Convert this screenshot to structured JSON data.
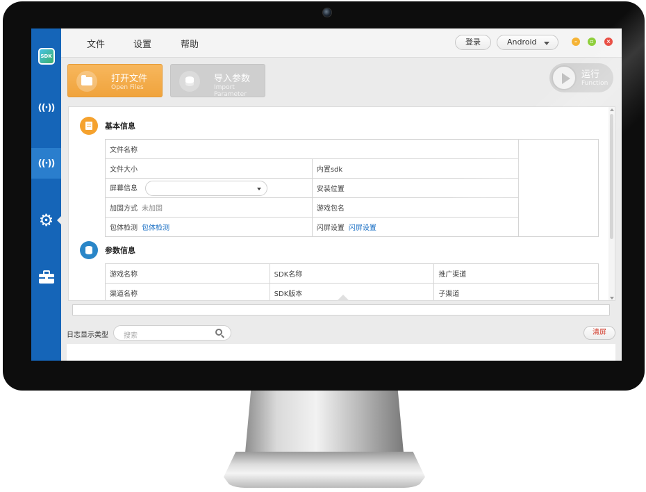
{
  "menu": {
    "file": "文件",
    "settings": "设置",
    "help": "帮助"
  },
  "header": {
    "login": "登录",
    "platform": "Android"
  },
  "sidebar": {
    "logo_text": "SDK",
    "items": [
      {
        "icon": "wireless-icon",
        "glyph": "((·))"
      },
      {
        "icon": "wireless-off-icon",
        "glyph": "((·))"
      },
      {
        "icon": "gear-icon",
        "glyph": "⚙"
      },
      {
        "icon": "toolbox-icon",
        "glyph": "🧰"
      }
    ]
  },
  "toolbar": {
    "open": {
      "title": "打开文件",
      "subtitle": "Open Files"
    },
    "import": {
      "title": "导入参数",
      "subtitle": "Import Parameter"
    },
    "run": {
      "title": "运行",
      "subtitle": "Function"
    }
  },
  "basic_info": {
    "title": "基本信息",
    "file_name": "文件名称",
    "file_size": "文件大小",
    "builtin_sdk": "内置sdk",
    "screen_info": "屏幕信息",
    "install_location": "安装位置",
    "protection_method": "加固方式",
    "protection_value": "未加固",
    "game_package": "游戏包名",
    "package_check": "包体检测",
    "package_check_link": "包体检测",
    "splash_settings": "闪屏设置",
    "splash_settings_link": "闪屏设置"
  },
  "params_info": {
    "title": "参数信息",
    "headers": [
      [
        "游戏名称",
        "SDK名称",
        "推广渠道"
      ],
      [
        "渠道名称",
        "SDK版本",
        "子渠道"
      ]
    ]
  },
  "log": {
    "label": "日志显示类型",
    "search_placeholder": "搜索",
    "clear": "清屏"
  },
  "colors": {
    "sidebar": "#1565b8",
    "open_button": "#f0a33c",
    "accent_link": "#1a6fc4",
    "minimize": "#f5b335",
    "maximize": "#8fcf3c",
    "close": "#e8473c"
  }
}
